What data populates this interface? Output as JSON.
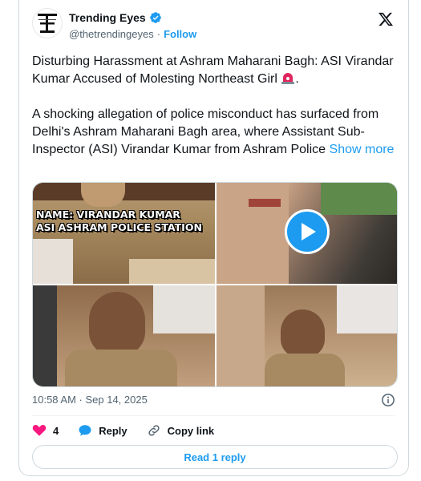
{
  "author": {
    "name": "Trending Eyes",
    "handle": "@thetrendingeyes",
    "separator": "·",
    "follow_label": "Follow",
    "avatar_icon": "trending-eyes-logo",
    "verified_icon": "verified-badge-icon"
  },
  "tweet": {
    "paragraph1": "Disturbing Harassment at Ashram Maharani Bagh: ASI Virandar Kumar Accused of Molesting Northeast Girl",
    "paragraph1_emoji": "police-siren-icon",
    "paragraph1_end": ".",
    "paragraph2": "A shocking allegation of police misconduct has surfaced from Delhi's Ashram Maharani Bagh area, where Assistant Sub-Inspector (ASI) Virandar Kumar from Ashram Police",
    "show_more_label": "Show more"
  },
  "media": {
    "caption_line1": "NAME: VIRANDAR KUMAR",
    "caption_line2": "ASI ASHRAM POLICE STATION",
    "play_icon": "play-icon"
  },
  "meta": {
    "timestamp": "10:58 AM · Sep 14, 2025"
  },
  "actions": {
    "like_count": "4",
    "reply_label": "Reply",
    "copy_link_label": "Copy link"
  },
  "read_reply_label": "Read 1 reply",
  "colors": {
    "accent": "#1d9bf0",
    "like": "#f91880",
    "text": "#0f1419",
    "secondary": "#536471"
  }
}
